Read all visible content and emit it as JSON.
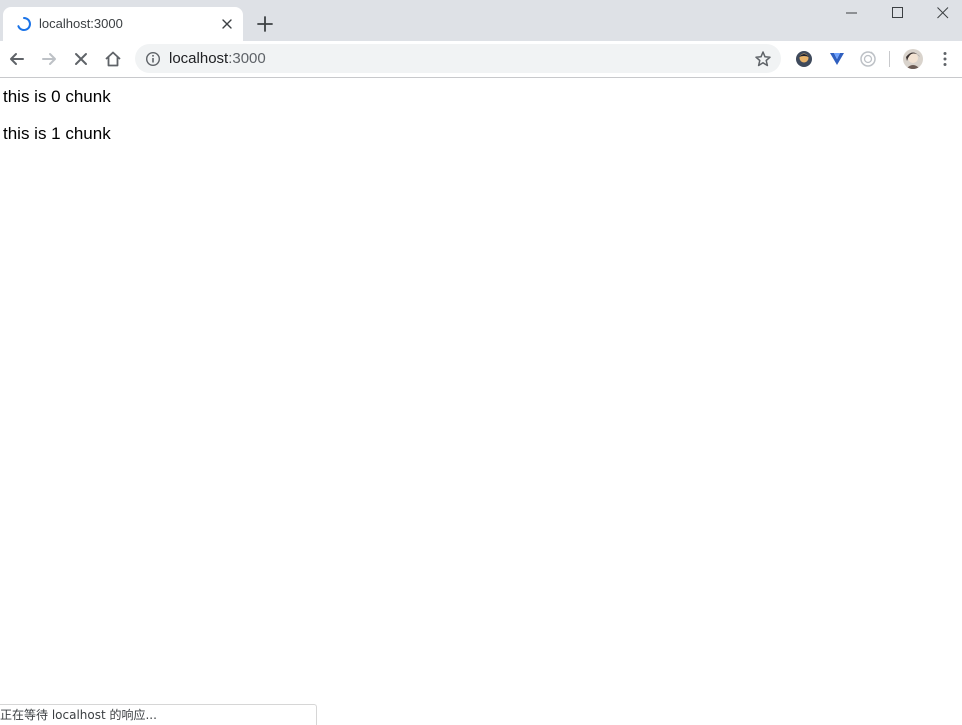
{
  "tab": {
    "title": "localhost:3000",
    "close_icon": "close-icon",
    "loading_icon": "loading-spinner-icon"
  },
  "new_tab_icon": "plus-icon",
  "window_controls": [
    "minimize-icon",
    "maximize-icon",
    "close-icon"
  ],
  "toolbar": {
    "back_icon": "arrow-left-icon",
    "forward_icon": "arrow-right-icon",
    "stop_icon": "stop-icon",
    "home_icon": "home-icon",
    "omnibox": {
      "host": "localhost",
      "port": ":3000",
      "info_icon": "info-icon",
      "star_icon": "star-icon"
    },
    "extensions": [
      "extension-icon-1",
      "extension-icon-2",
      "extension-icon-3"
    ],
    "profile_icon": "avatar",
    "menu_icon": "more-vert-icon"
  },
  "content": {
    "lines": [
      "this is 0 chunk",
      "this is 1 chunk"
    ]
  },
  "status": {
    "text": "正在等待 localhost 的响应..."
  },
  "colors": {
    "tabstrip": "#dee1e6",
    "omnibox": "#f1f3f4",
    "spinner": "#1a73e8",
    "icon": "#5f6368"
  }
}
